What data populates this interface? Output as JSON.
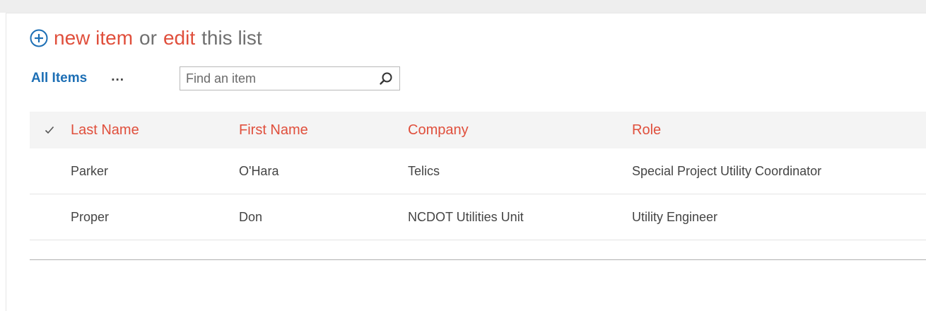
{
  "heading": {
    "new_item": "new item",
    "or": "or",
    "edit": "edit",
    "this_list": "this list"
  },
  "views": {
    "all_items": "All Items",
    "more": "..."
  },
  "search": {
    "placeholder": "Find an item",
    "value": ""
  },
  "table": {
    "columns": [
      "Last Name",
      "First Name",
      "Company",
      "Role"
    ],
    "rows": [
      [
        "Parker",
        "O'Hara",
        "Telics",
        "Special Project Utility Coordinator"
      ],
      [
        "Proper",
        "Don",
        "NCDOT Utilities Unit",
        "Utility Engineer"
      ]
    ]
  },
  "colors": {
    "accent_red": "#e04f3c",
    "link_blue": "#1d6fb5",
    "text_gray": "#707070"
  },
  "icons": {
    "add": "circle-plus-icon",
    "search": "magnifier-icon",
    "check": "checkmark-icon"
  }
}
